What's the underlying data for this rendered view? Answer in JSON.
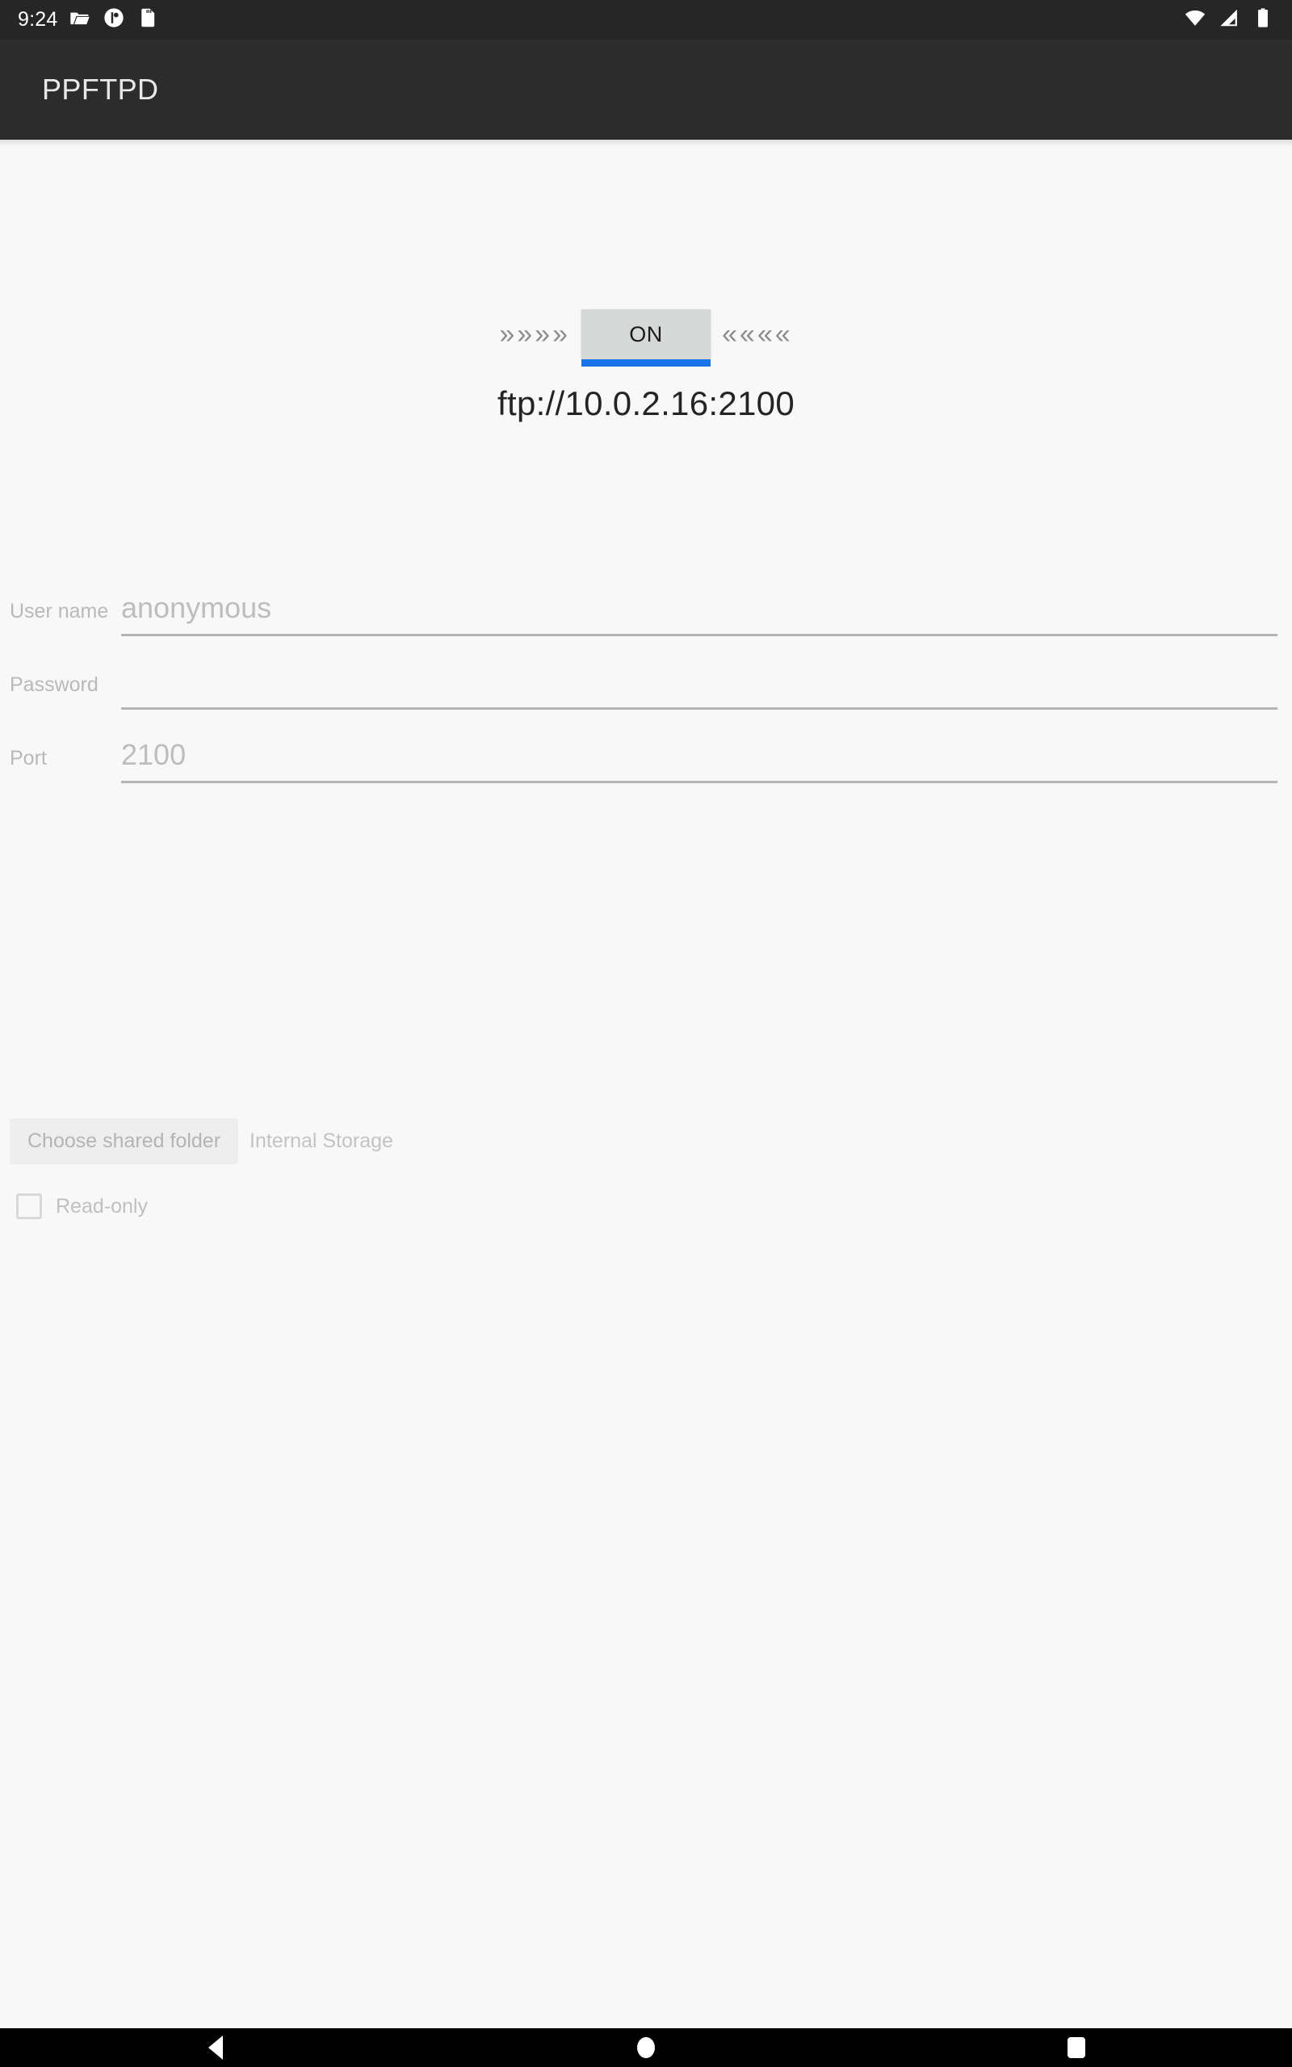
{
  "status_bar": {
    "time": "9:24",
    "left_icons": [
      "folder-icon",
      "app-circle-icon",
      "sd-card-icon"
    ],
    "right_icons": [
      "wifi-icon",
      "cellular-signal-icon",
      "battery-icon"
    ],
    "background": "#262626"
  },
  "app_bar": {
    "title": "PPFTPD",
    "background": "#2c2c2c",
    "title_color": "#e8e8e8"
  },
  "server": {
    "chevrons_left": "»»»»",
    "chevrons_right": "««««",
    "toggle_label": "ON",
    "toggle_background": "#d6d7d7",
    "toggle_accent": "#1a73e8",
    "url": "ftp://10.0.2.16:2100"
  },
  "form": {
    "fields": [
      {
        "label": "User name",
        "value": "anonymous",
        "name": "username"
      },
      {
        "label": "Password",
        "value": "",
        "name": "password"
      },
      {
        "label": "Port",
        "value": "2100",
        "name": "port"
      }
    ]
  },
  "shared_folder": {
    "button_label": "Choose shared folder",
    "path": "Internal Storage"
  },
  "read_only": {
    "label": "Read-only",
    "checked": false
  },
  "nav_bar": {
    "back": "back-icon",
    "home": "home-icon",
    "recents": "recents-icon"
  }
}
